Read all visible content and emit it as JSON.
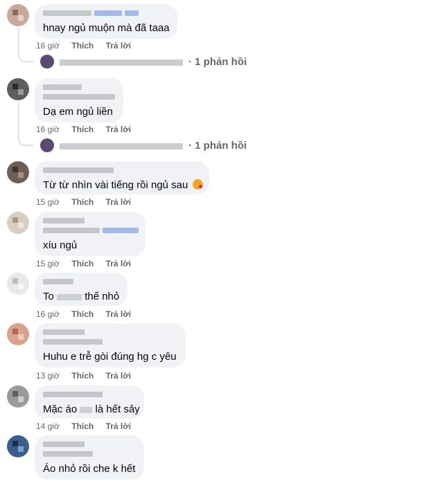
{
  "comments": [
    {
      "text": "hnay ngủ muộn mà đã taaa",
      "time": "16 giờ",
      "like": "Thích",
      "reply": "Trả lời",
      "replies": "· 1 phản hồi"
    },
    {
      "text": "Dạ em ngủ liền",
      "time": "16 giờ",
      "like": "Thích",
      "reply": "Trả lời",
      "replies": "· 1 phản hồi"
    },
    {
      "text": "Từ từ nhìn vài tiếng rồi ngủ sau",
      "emoji": "kissing-face-icon",
      "time": "15 giờ",
      "like": "Thích",
      "reply": "Trả lời"
    },
    {
      "text": "xíu ngủ",
      "time": "15 giờ",
      "like": "Thích",
      "reply": "Trả lời"
    },
    {
      "text_a": "To",
      "text_b": "thế nhỏ",
      "time": "16 giờ",
      "like": "Thích",
      "reply": "Trả lời"
    },
    {
      "text": "Huhu e trễ gòi đúng hg c yêu",
      "time": "13 giờ",
      "like": "Thích",
      "reply": "Trả lời"
    },
    {
      "text_a": "Mặc áo",
      "text_b": "là hết sảy",
      "time": "14 giờ",
      "like": "Thích",
      "reply": "Trả lời"
    },
    {
      "text": "Áo nhỏ rồi che k hết"
    }
  ],
  "colors": {
    "bubble": "#f0f2f5",
    "meta": "#65676b",
    "text": "#050505"
  }
}
